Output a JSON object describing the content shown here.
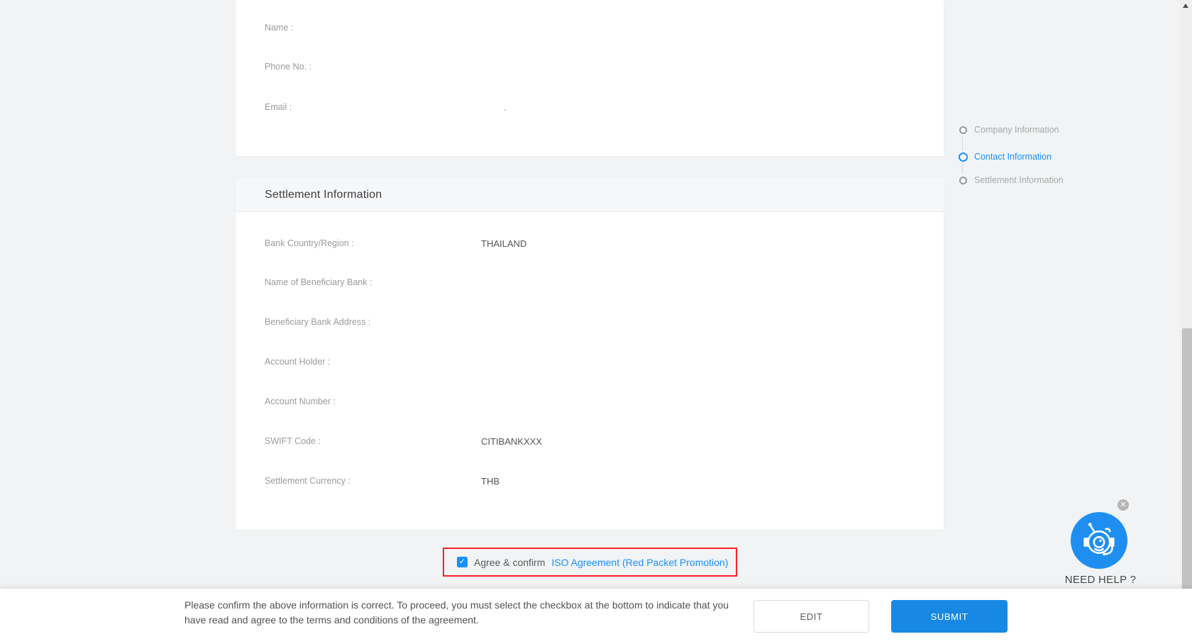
{
  "page": {
    "background_color": "#f1f3f5",
    "accent_blue": "#1890ff",
    "highlight_red": "#fb2125"
  },
  "contact_section": {
    "fields": [
      {
        "label": "Name :",
        "value": ""
      },
      {
        "label": "Phone No. :",
        "value": ""
      },
      {
        "label": "Email :",
        "value": "."
      }
    ]
  },
  "settlement_section": {
    "title": "Settlement Information",
    "fields": [
      {
        "label": "Bank Country/Region :",
        "value": "THAILAND"
      },
      {
        "label": "Name of Beneficiary Bank :",
        "value": ""
      },
      {
        "label": "Beneficiary Bank Address :",
        "value": ""
      },
      {
        "label": "Account Holder :",
        "value": ""
      },
      {
        "label": "Account Number :",
        "value": ""
      },
      {
        "label": "SWIFT Code :",
        "value": "CITIBANKXXX"
      },
      {
        "label": "Settlement Currency :",
        "value": "THB"
      }
    ]
  },
  "stepper": {
    "items": [
      {
        "label": "Company Information",
        "state": "inactive"
      },
      {
        "label": "Contact Information",
        "state": "active"
      },
      {
        "label": "Settlement Information",
        "state": "inactive"
      }
    ]
  },
  "agreement": {
    "checked": true,
    "checkmark": "✓",
    "label": "Agree & confirm",
    "link": "ISO Agreement (Red Packet Promotion)"
  },
  "footer": {
    "notice_line1": "Please confirm the above information is correct. To proceed, you must select the checkbox at the bottom to indicate that you",
    "notice_line2": "have read and agree to the terms and conditions of the agreement.",
    "edit_label": "EDIT",
    "submit_label": "SUBMIT"
  },
  "help_widget": {
    "label": "NEED HELP ?",
    "close": "✕"
  }
}
